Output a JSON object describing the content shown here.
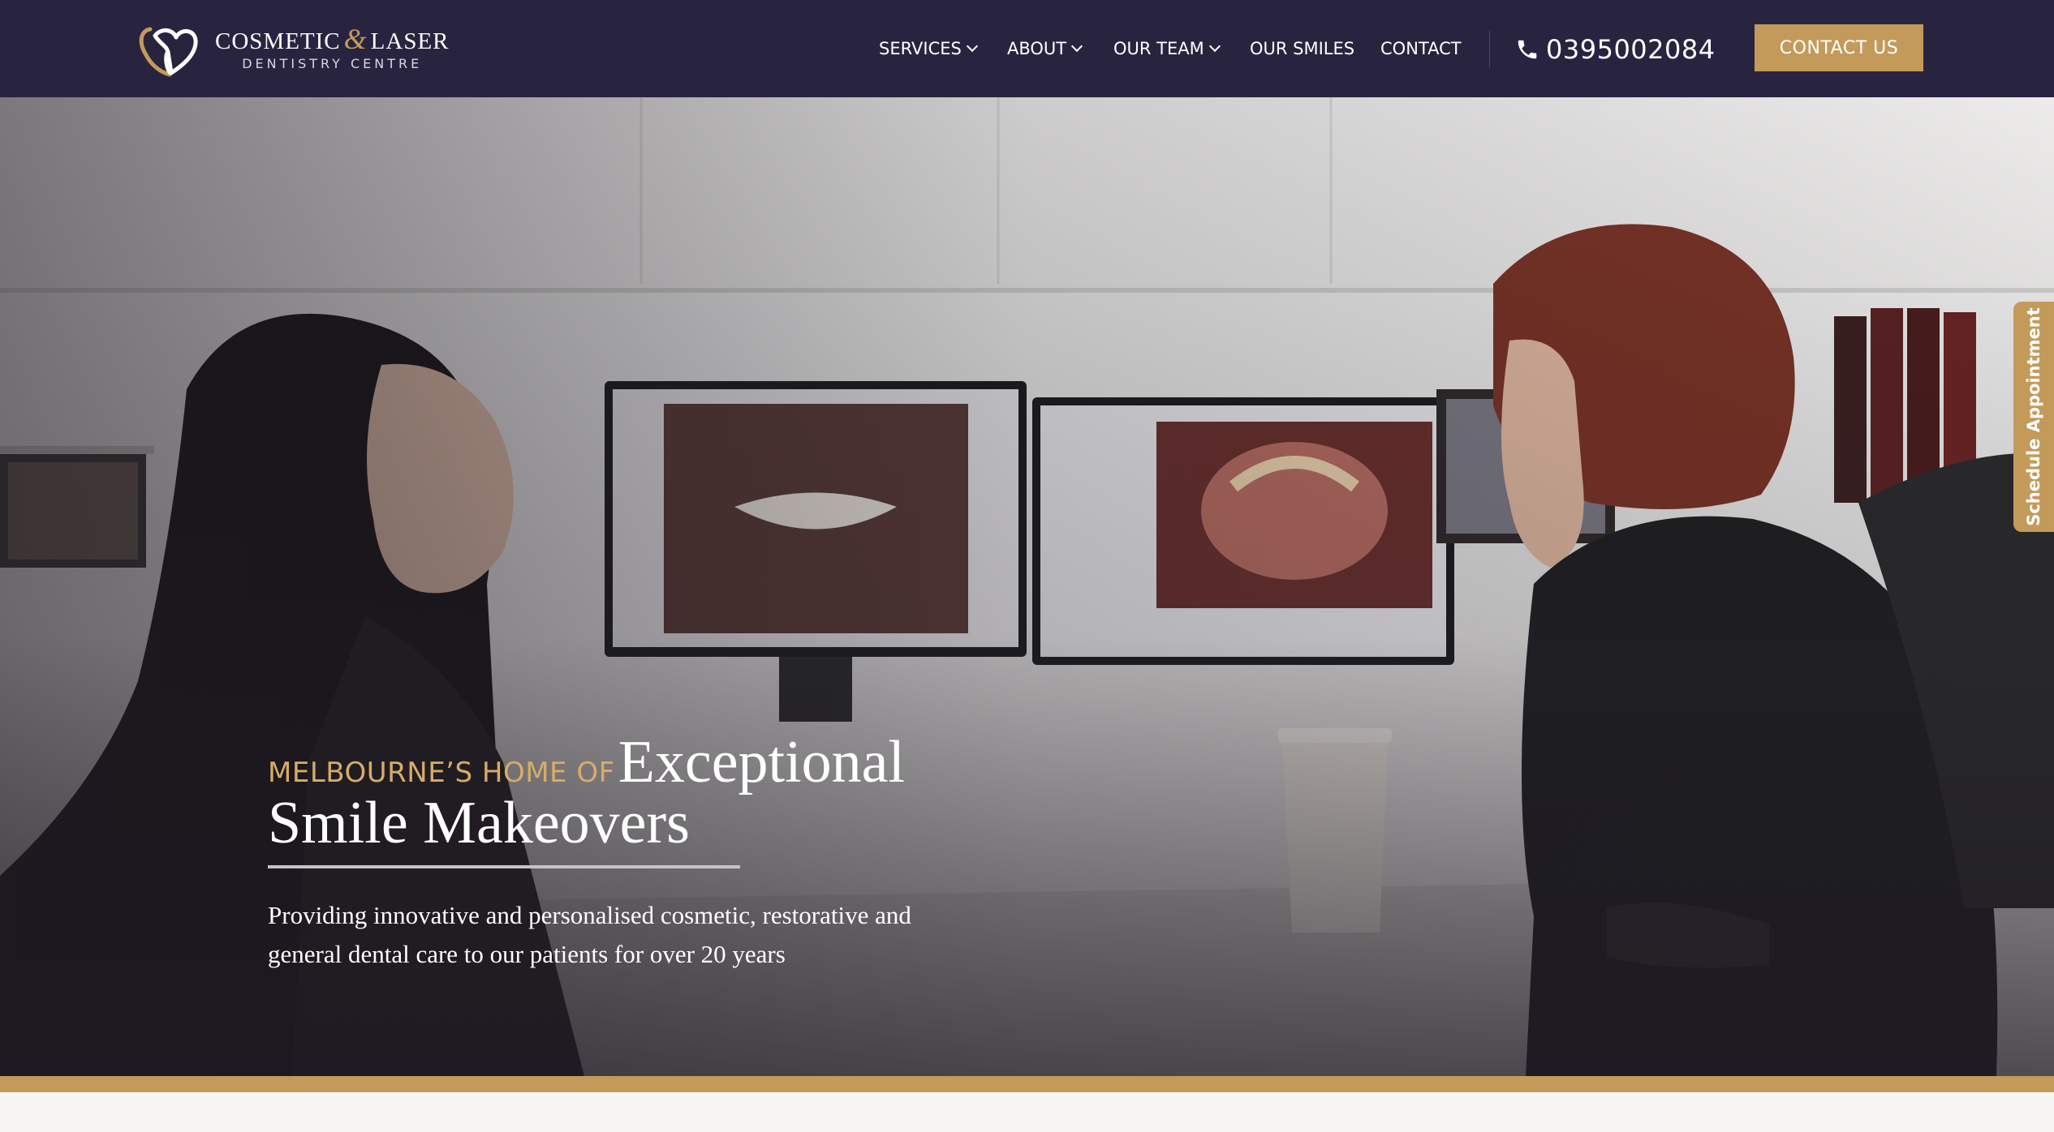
{
  "brand": {
    "line1_a": "COSMETIC",
    "line1_amp": "&",
    "line1_b": "LASER",
    "line2": "DENTISTRY CENTRE"
  },
  "nav": {
    "items": [
      {
        "label": "SERVICES",
        "dropdown": true
      },
      {
        "label": "ABOUT",
        "dropdown": true
      },
      {
        "label": "OUR TEAM",
        "dropdown": true
      },
      {
        "label": "OUR SMILES",
        "dropdown": false
      },
      {
        "label": "CONTACT",
        "dropdown": false
      }
    ],
    "phone": "0395002084",
    "cta_label": "CONTACT US"
  },
  "hero": {
    "eyebrow": "MELBOURNE’S HOME OF",
    "title_part1": "Exceptional",
    "title_part2": "Smile Makeovers",
    "subtitle_line1": "Providing innovative and personalised cosmetic, restorative and",
    "subtitle_line2": "general dental care to our patients for over 20 years"
  },
  "side_tab": {
    "label": "Schedule Appointment"
  },
  "colors": {
    "header_bg": "#282440",
    "accent_gold": "#c49a5a",
    "eyebrow_gold": "#d6ac68",
    "text_white": "#ffffff"
  },
  "icons": {
    "logo": "tooth-heart-logo-icon",
    "phone": "phone-icon",
    "dropdown": "chevron-down-icon"
  }
}
